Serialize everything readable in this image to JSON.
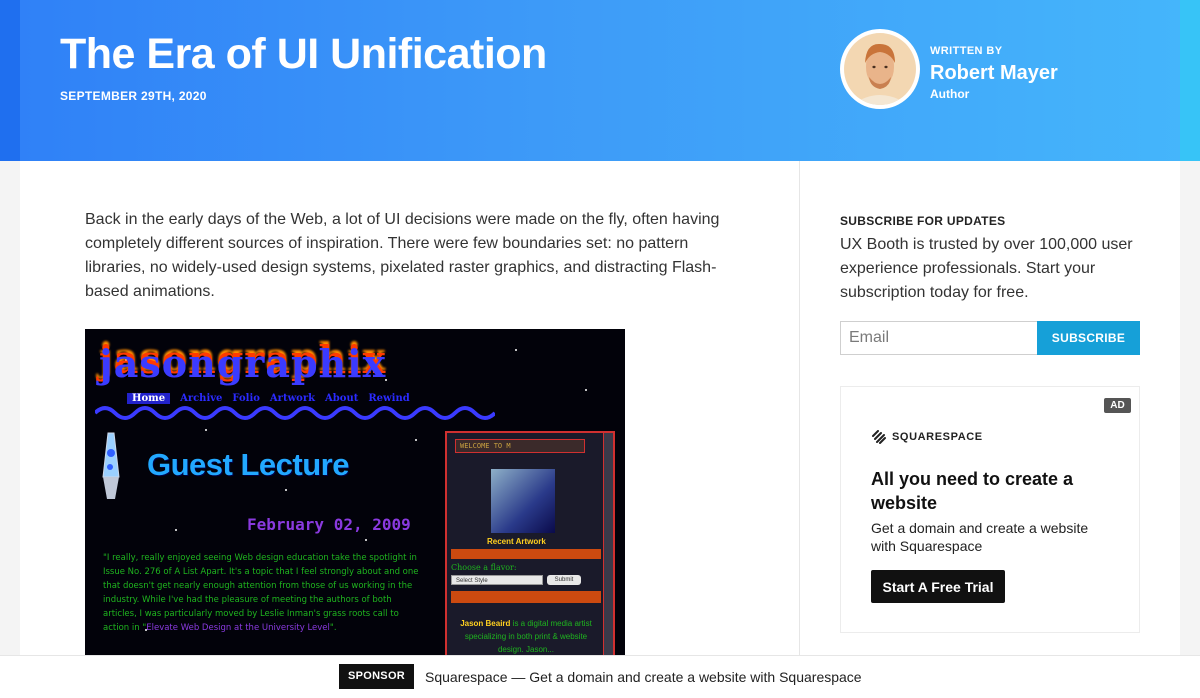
{
  "header": {
    "title": "The Era of UI Unification",
    "date": "SEPTEMBER 29TH, 2020",
    "author": {
      "written_by": "WRITTEN BY",
      "name": "Robert Mayer",
      "role": "Author"
    }
  },
  "article": {
    "intro": "Back in the early days of the Web, a lot of UI decisions were made on the fly, often having completely different sources of inspiration. There were few boundaries set: no pattern libraries, no widely-used design systems, pixelated raster graphics, and distracting Flash-based animations.",
    "figure": {
      "logo": "jasongraphix",
      "nav": [
        "Home",
        "Archive",
        "Folio",
        "Artwork",
        "About",
        "Rewind"
      ],
      "lecture": "Guest Lecture",
      "date": "February 02, 2009",
      "quote_a": "\"I really, really enjoyed seeing Web design education take the spotlight in Issue No. 276 of A List Apart. It's a topic that I feel strongly about and one that doesn't get nearly enough attention from those of us working in the industry. While I've had the pleasure of meeting the authors of both articles, I was particularly moved by Leslie Inman's grass roots call to action in \"",
      "quote_link": "Elevate Web Design at the University Level",
      "quote_b": "\".",
      "panel": {
        "welcome": "WELCOME TO M",
        "recent": "Recent Artwork",
        "flavor": "Choose a flavor:",
        "select": "Select Style",
        "submit": "Submit",
        "bio_name": "Jason Beaird",
        "bio_text": " is a digital media artist specializing in both print & website design. Jason..."
      }
    }
  },
  "sidebar": {
    "subscribe_heading": "SUBSCRIBE FOR UPDATES",
    "subscribe_text": "UX Booth is trusted by over 100,000 user experience professionals. Start your subscription today for free.",
    "email_placeholder": "Email",
    "subscribe_button": "SUBSCRIBE",
    "ad": {
      "badge": "AD",
      "brand": "SQUARESPACE",
      "headline": "All you need to create a website",
      "description": "Get a domain and create a website with Squarespace",
      "cta": "Start A Free Trial"
    }
  },
  "sponsor": {
    "tag": "SPONSOR",
    "text": "Squarespace — Get a domain and create a website with Squarespace"
  },
  "colors": {
    "header_start": "#2f80f7",
    "header_end": "#45b6fb",
    "subscribe_button": "#16a0d8",
    "ad_cta": "#111111"
  }
}
